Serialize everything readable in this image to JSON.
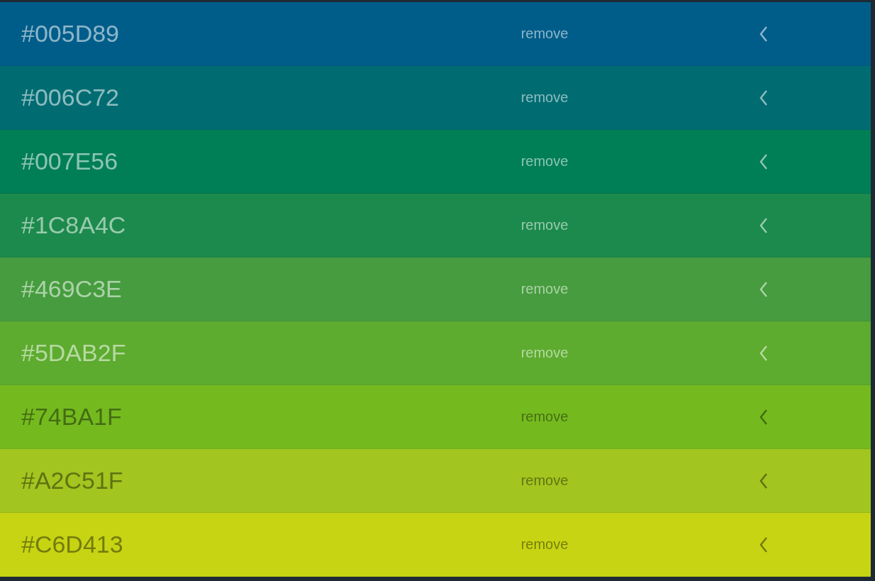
{
  "colors": [
    {
      "hex": "#005D89",
      "color": "#005d89",
      "action": "remove"
    },
    {
      "hex": "#006C72",
      "color": "#006c72",
      "action": "remove"
    },
    {
      "hex": "#007E56",
      "color": "#007e56",
      "action": "remove"
    },
    {
      "hex": "#1C8A4C",
      "color": "#1c8a4c",
      "action": "remove"
    },
    {
      "hex": "#469C3E",
      "color": "#469c3e",
      "action": "remove"
    },
    {
      "hex": "#5DAB2F",
      "color": "#5dab2f",
      "action": "remove"
    },
    {
      "hex": "#74BA1F",
      "color": "#74ba1f",
      "action": "remove"
    },
    {
      "hex": "#A2C51F",
      "color": "#a2c51f",
      "action": "remove"
    },
    {
      "hex": "#C6D413",
      "color": "#c6d413",
      "action": "remove"
    }
  ]
}
